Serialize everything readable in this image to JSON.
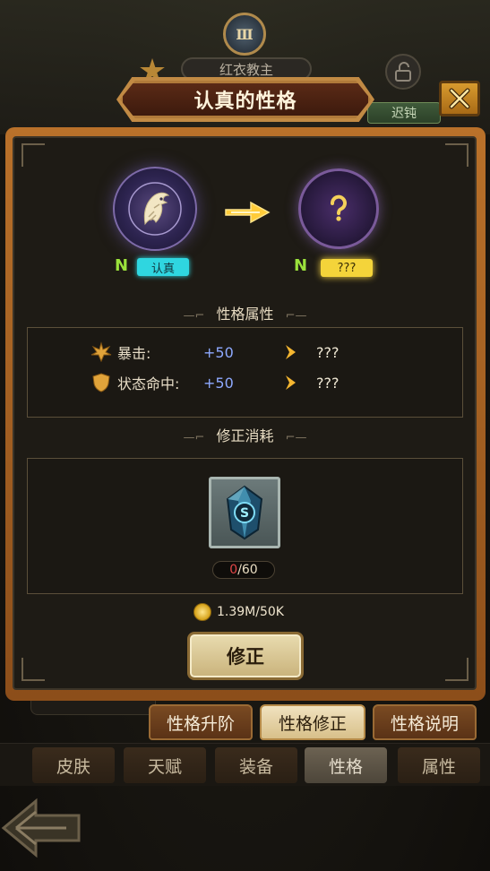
{
  "header": {
    "rank_numeral": "Ⅲ",
    "hero_name": "红衣教主",
    "status_tag": "迟钝"
  },
  "dialog": {
    "title": "认真的性格",
    "current": {
      "grade": "N",
      "trait": "认真",
      "icon": "eagle-emblem-icon"
    },
    "next": {
      "grade": "N",
      "trait": "???",
      "icon": "question-mark-icon"
    },
    "attributes_title": "性格属性",
    "attributes": [
      {
        "icon": "crit-burst-icon",
        "label": "暴击:",
        "value": "+50",
        "next": "???"
      },
      {
        "icon": "shield-icon",
        "label": "状态命中:",
        "value": "+50",
        "next": "???"
      }
    ],
    "cost_title": "修正消耗",
    "material": {
      "icon": "blue-crystal-icon",
      "have": "0",
      "need": "/60"
    },
    "gold": {
      "icon": "gold-coin-icon",
      "text": "1.39M/50K"
    },
    "action_label": "修正"
  },
  "sub_tabs": [
    {
      "label": "性格升阶",
      "active": false
    },
    {
      "label": "性格修正",
      "active": true
    },
    {
      "label": "性格说明",
      "active": false
    }
  ],
  "main_tabs": [
    {
      "label": "皮肤",
      "active": false
    },
    {
      "label": "天赋",
      "active": false
    },
    {
      "label": "装备",
      "active": false
    },
    {
      "label": "性格",
      "active": true
    },
    {
      "label": "属性",
      "active": false
    }
  ],
  "colors": {
    "grade": "#9be23c",
    "current_tag": "#2fd6e0",
    "next_tag": "#f4d43a",
    "attr_value": "#8ea9ff",
    "have_insufficient": "#e24747",
    "panel_frame": "#b9712a"
  }
}
